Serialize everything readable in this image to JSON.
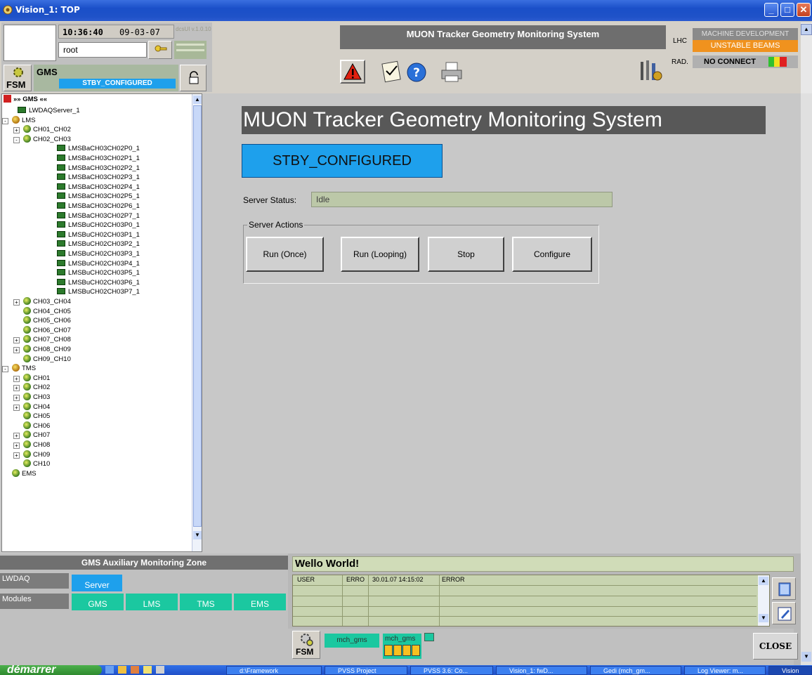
{
  "window": {
    "title": "Vision_1: TOP"
  },
  "session": {
    "time": "10:36:40",
    "date": "09-03-07",
    "version": "dcsUI v.1.0.10",
    "user": "root"
  },
  "fsm_head": {
    "fsm_label": "FSM",
    "node": "GMS",
    "state": "STBY_CONFIGURED"
  },
  "header": {
    "title": "MUON Tracker Geometry Monitoring System"
  },
  "lhc": {
    "lhc_label": "LHC",
    "rad_label": "RAD.",
    "mode": "MACHINE DEVELOPMENT",
    "beam": "UNSTABLE BEAMS",
    "connect": "NO CONNECT"
  },
  "tree": {
    "root": "»» GMS ««",
    "items": [
      {
        "label": "LWDAQServer_1"
      },
      {
        "label": "LMS"
      },
      {
        "label": "CH01_CH02"
      },
      {
        "label": "CH02_CH03"
      },
      {
        "label": "LMSBaCH03CH02P0_1"
      },
      {
        "label": "LMSBaCH03CH02P1_1"
      },
      {
        "label": "LMSBaCH03CH02P2_1"
      },
      {
        "label": "LMSBaCH03CH02P3_1"
      },
      {
        "label": "LMSBaCH03CH02P4_1"
      },
      {
        "label": "LMSBaCH03CH02P5_1"
      },
      {
        "label": "LMSBaCH03CH02P6_1"
      },
      {
        "label": "LMSBaCH03CH02P7_1"
      },
      {
        "label": "LMSBuCH02CH03P0_1"
      },
      {
        "label": "LMSBuCH02CH03P1_1"
      },
      {
        "label": "LMSBuCH02CH03P2_1"
      },
      {
        "label": "LMSBuCH02CH03P3_1"
      },
      {
        "label": "LMSBuCH02CH03P4_1"
      },
      {
        "label": "LMSBuCH02CH03P5_1"
      },
      {
        "label": "LMSBuCH02CH03P6_1"
      },
      {
        "label": "LMSBuCH02CH03P7_1"
      },
      {
        "label": "CH03_CH04"
      },
      {
        "label": "CH04_CH05"
      },
      {
        "label": "CH05_CH06"
      },
      {
        "label": "CH06_CH07"
      },
      {
        "label": "CH07_CH08"
      },
      {
        "label": "CH08_CH09"
      },
      {
        "label": "CH09_CH10"
      },
      {
        "label": "TMS"
      },
      {
        "label": "CH01"
      },
      {
        "label": "CH02"
      },
      {
        "label": "CH03"
      },
      {
        "label": "CH04"
      },
      {
        "label": "CH05"
      },
      {
        "label": "CH06"
      },
      {
        "label": "CH07"
      },
      {
        "label": "CH08"
      },
      {
        "label": "CH09"
      },
      {
        "label": "CH10"
      },
      {
        "label": "EMS"
      }
    ]
  },
  "main": {
    "title": "MUON Tracker Geometry Monitoring System",
    "state": "STBY_CONFIGURED",
    "server_status_label": "Server Status:",
    "server_status_value": "Idle",
    "actions_label": "Server Actions",
    "buttons": {
      "run_once": "Run (Once)",
      "run_looping": "Run (Looping)",
      "stop": "Stop",
      "configure": "Configure"
    }
  },
  "aux": {
    "title": "GMS Auxiliary Monitoring Zone",
    "lwdaq_label": "LWDAQ",
    "server": "Server",
    "modules_label": "Modules",
    "modules": [
      "GMS",
      "LMS",
      "TMS",
      "EMS"
    ]
  },
  "log": {
    "title": "Wello World!",
    "row": {
      "user": "USER",
      "code": "ERRO",
      "time": "30.01.07 14:15:02",
      "level": "ERROR"
    }
  },
  "footer": {
    "fsm_label": "FSM",
    "tag1": "mch_gms",
    "tag2": "mch_gms",
    "close": "CLOSE"
  },
  "taskbar": {
    "start": "démarrer",
    "tasks": [
      "d:\\Framework",
      "PVSS Project",
      "PVSS 3.6: Co...",
      "Vision_1: fwD...",
      "Gedi (mch_gm...",
      "Log Viewer: m...",
      "Vision"
    ]
  },
  "colors": {
    "titlebar": "#1f52c8",
    "state_blue": "#1ea0ec",
    "module_teal": "#1bc8a0",
    "beam_orange": "#f0921e"
  }
}
